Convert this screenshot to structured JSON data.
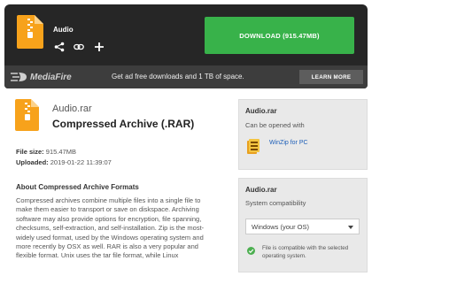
{
  "header": {
    "app_title": "Audio",
    "download_label": "DOWNLOAD (915.47MB)",
    "actions": [
      "share-icon",
      "link-icon",
      "plus-icon"
    ]
  },
  "promo": {
    "logo_text": "MediaFire",
    "message": "Get ad free downloads and 1 TB of space.",
    "learn_more": "LEARN MORE"
  },
  "file": {
    "name": "Audio.rar",
    "type": "Compressed Archive (.RAR)",
    "size_label": "File size:",
    "size": "915.47MB",
    "uploaded_label": "Uploaded:",
    "uploaded": "2019-01-22 11:39:07"
  },
  "about": {
    "title": "About Compressed Archive Formats",
    "text": "Compressed archives combine multiple files into a single file to make them easier to transport or save on diskspace. Archiving software may also provide options for encryption, file spanning, checksums, self-extraction, and self-installation. Zip is the most-widely used format, used by the Windows operating system and more recently by OSX as well. RAR is also a very popular and flexible format. Unix uses the tar file format, while Linux"
  },
  "sidebar": {
    "card1": {
      "title": "Audio.rar",
      "subtitle": "Can be opened with",
      "app_link": "WinZip for PC"
    },
    "card2": {
      "title": "Audio.rar",
      "subtitle": "System compatibility",
      "selected_os": "Windows (your OS)",
      "compat_message": "File is compatible with the selected operating system."
    }
  },
  "colors": {
    "header_bg": "#262626",
    "download_green": "#38b24a",
    "promo_bg": "#3d3d3d",
    "link_blue": "#1d5fb8",
    "card_bg": "#e9e9e9"
  }
}
